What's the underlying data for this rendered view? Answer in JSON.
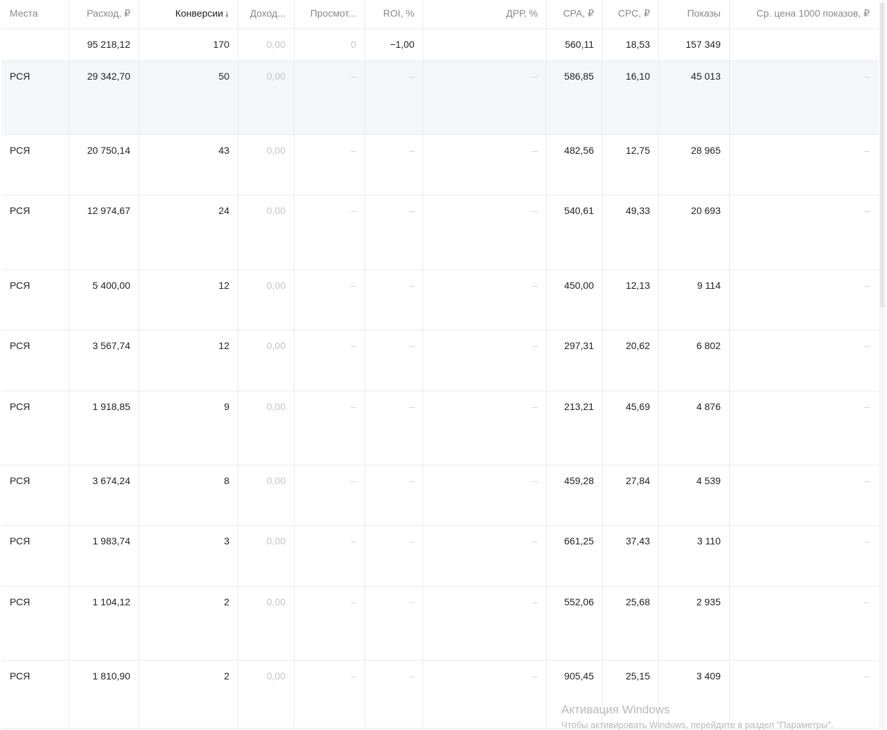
{
  "headers": [
    "Места",
    "Расход, ₽",
    "Конверсии",
    "Доход...",
    "Просмот...",
    "ROI, %",
    "ДРР, %",
    "CPA, ₽",
    "CPC, ₽",
    "Показы",
    "Ср. цена 1000 показов, ₽"
  ],
  "sort_icon_glyph": "↓",
  "totals": {
    "expense": "95 218,12",
    "conversions": "170",
    "income": "0,00",
    "views": "0",
    "roi": "−1,00",
    "drr": "",
    "cpa": "560,11",
    "cpc": "18,53",
    "impressions": "157 349",
    "cpm": ""
  },
  "dash": "–",
  "rows": [
    {
      "place": "РСЯ",
      "expense": "29 342,70",
      "conversions": "50",
      "income": "0,00",
      "cpa": "586,85",
      "cpc": "16,10",
      "impressions": "45 013"
    },
    {
      "place": "РСЯ",
      "expense": "20 750,14",
      "conversions": "43",
      "income": "0,00",
      "cpa": "482,56",
      "cpc": "12,75",
      "impressions": "28 965"
    },
    {
      "place": "РСЯ",
      "expense": "12 974,67",
      "conversions": "24",
      "income": "0,00",
      "cpa": "540,61",
      "cpc": "49,33",
      "impressions": "20 693"
    },
    {
      "place": "РСЯ",
      "expense": "5 400,00",
      "conversions": "12",
      "income": "0,00",
      "cpa": "450,00",
      "cpc": "12,13",
      "impressions": "9 114"
    },
    {
      "place": "РСЯ",
      "expense": "3 567,74",
      "conversions": "12",
      "income": "0,00",
      "cpa": "297,31",
      "cpc": "20,62",
      "impressions": "6 802"
    },
    {
      "place": "РСЯ",
      "expense": "1 918,85",
      "conversions": "9",
      "income": "0,00",
      "cpa": "213,21",
      "cpc": "45,69",
      "impressions": "4 876"
    },
    {
      "place": "РСЯ",
      "expense": "3 674,24",
      "conversions": "8",
      "income": "0,00",
      "cpa": "459,28",
      "cpc": "27,84",
      "impressions": "4 539"
    },
    {
      "place": "РСЯ",
      "expense": "1 983,74",
      "conversions": "3",
      "income": "0,00",
      "cpa": "661,25",
      "cpc": "37,43",
      "impressions": "3 110"
    },
    {
      "place": "РСЯ",
      "expense": "1 104,12",
      "conversions": "2",
      "income": "0,00",
      "cpa": "552,06",
      "cpc": "25,68",
      "impressions": "2 935"
    },
    {
      "place": "РСЯ",
      "expense": "1 810,90",
      "conversions": "2",
      "income": "0,00",
      "cpa": "905,45",
      "cpc": "25,15",
      "impressions": "3 409"
    }
  ],
  "activation": {
    "title": "Активация Windows",
    "subtitle": "Чтобы активировать Windows, перейдите в раздел \"Параметры\"."
  }
}
